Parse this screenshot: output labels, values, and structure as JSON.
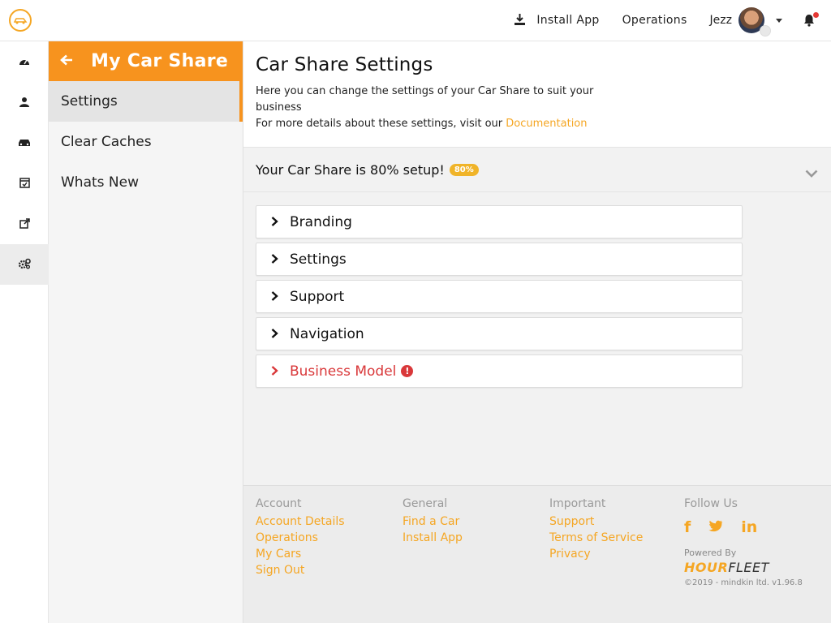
{
  "topbar": {
    "install_label": "Install App",
    "operations_label": "Operations",
    "user_name": "Jezz"
  },
  "subnav": {
    "title": "My Car Share",
    "items": [
      {
        "label": "Settings",
        "active": true
      },
      {
        "label": "Clear Caches",
        "active": false
      },
      {
        "label": "Whats New",
        "active": false
      }
    ]
  },
  "main": {
    "title": "Car Share Settings",
    "intro_line1": "Here you can change the settings of your Car Share to suit your business",
    "intro_line2": "For more details about these settings, visit our",
    "doc_link": "Documentation",
    "progress_text": "Your Car Share is 80% setup!",
    "progress_badge": "80%",
    "progress_fraction": 0.8,
    "panels": [
      {
        "label": "Branding"
      },
      {
        "label": "Settings"
      },
      {
        "label": "Support"
      },
      {
        "label": "Navigation"
      },
      {
        "label": "Business Model"
      }
    ]
  },
  "footer": {
    "account": {
      "heading": "Account",
      "links": [
        "Account Details",
        "Operations",
        "My Cars",
        "Sign Out"
      ]
    },
    "general": {
      "heading": "General",
      "links": [
        "Find a Car",
        "Install App"
      ]
    },
    "important": {
      "heading": "Important",
      "links": [
        "Support",
        "Terms of Service",
        "Privacy"
      ]
    },
    "follow": {
      "heading": "Follow Us",
      "icons": [
        "facebook-icon",
        "twitter-icon",
        "linkedin-icon"
      ]
    },
    "powered_by": "Powered By",
    "brand_hour": "HOUR",
    "brand_fleet": "FLEET",
    "copyright": "©2019 - mindkin ltd. v1.96.8"
  },
  "colors": {
    "accent": "#f7931e",
    "link": "#f5a623",
    "warning": "#d9383a"
  }
}
